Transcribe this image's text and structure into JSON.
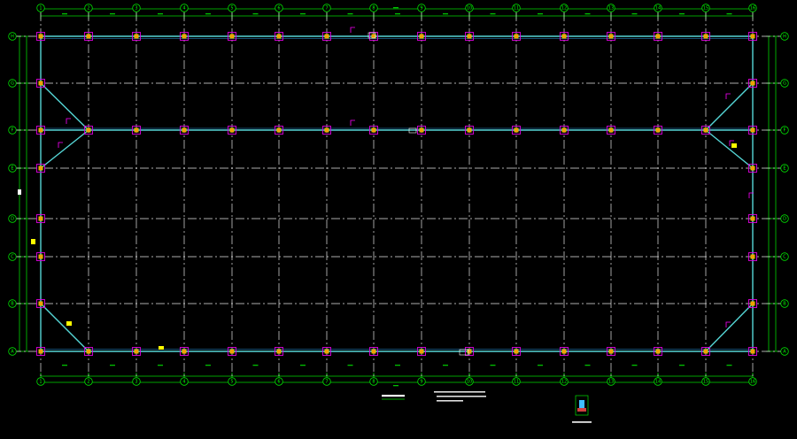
{
  "drawing": {
    "background": "#000000",
    "colors": {
      "grid": "#e6e6e6",
      "dimension": "#00d400",
      "beam": "#55d6d6",
      "column": "#e000e0",
      "column_core": "#f0a000",
      "annotation": "#ff00ff"
    },
    "axes": {
      "numbered": [
        "1",
        "2",
        "3",
        "4",
        "5",
        "6",
        "7",
        "8",
        "9",
        "10",
        "11",
        "12",
        "13",
        "14",
        "15",
        "16"
      ],
      "lettered": [
        "A",
        "B",
        "C",
        "D",
        "E",
        "F",
        "G",
        "H"
      ]
    }
  }
}
